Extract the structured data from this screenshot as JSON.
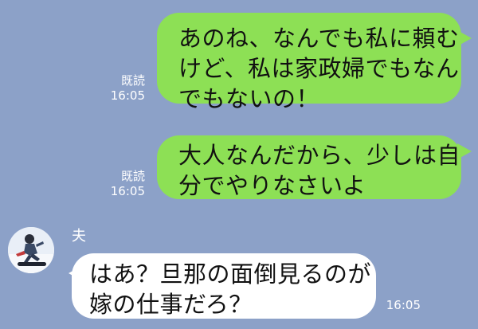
{
  "messages": [
    {
      "type": "sent",
      "lines": [
        "あのね、なんでも私に頼む",
        "けど、私は家政婦でもなん",
        "でもないの！"
      ],
      "read_label": "既読",
      "time": "16:05"
    },
    {
      "type": "sent",
      "lines": [
        "大人なんだから、少しは自",
        "分でやりなさいよ"
      ],
      "read_label": "既読",
      "time": "16:05"
    },
    {
      "type": "received",
      "sender": "夫",
      "avatar_icon": "snowboarder-avatar-icon",
      "lines": [
        "はあ？旦那の面倒見るのが",
        "嫁の仕事だろ？"
      ],
      "time": "16:05"
    }
  ],
  "colors": {
    "background": "#8ca1c8",
    "sent_bubble": "#8de055",
    "received_bubble": "#ffffff",
    "meta_text": "#ffffff"
  }
}
